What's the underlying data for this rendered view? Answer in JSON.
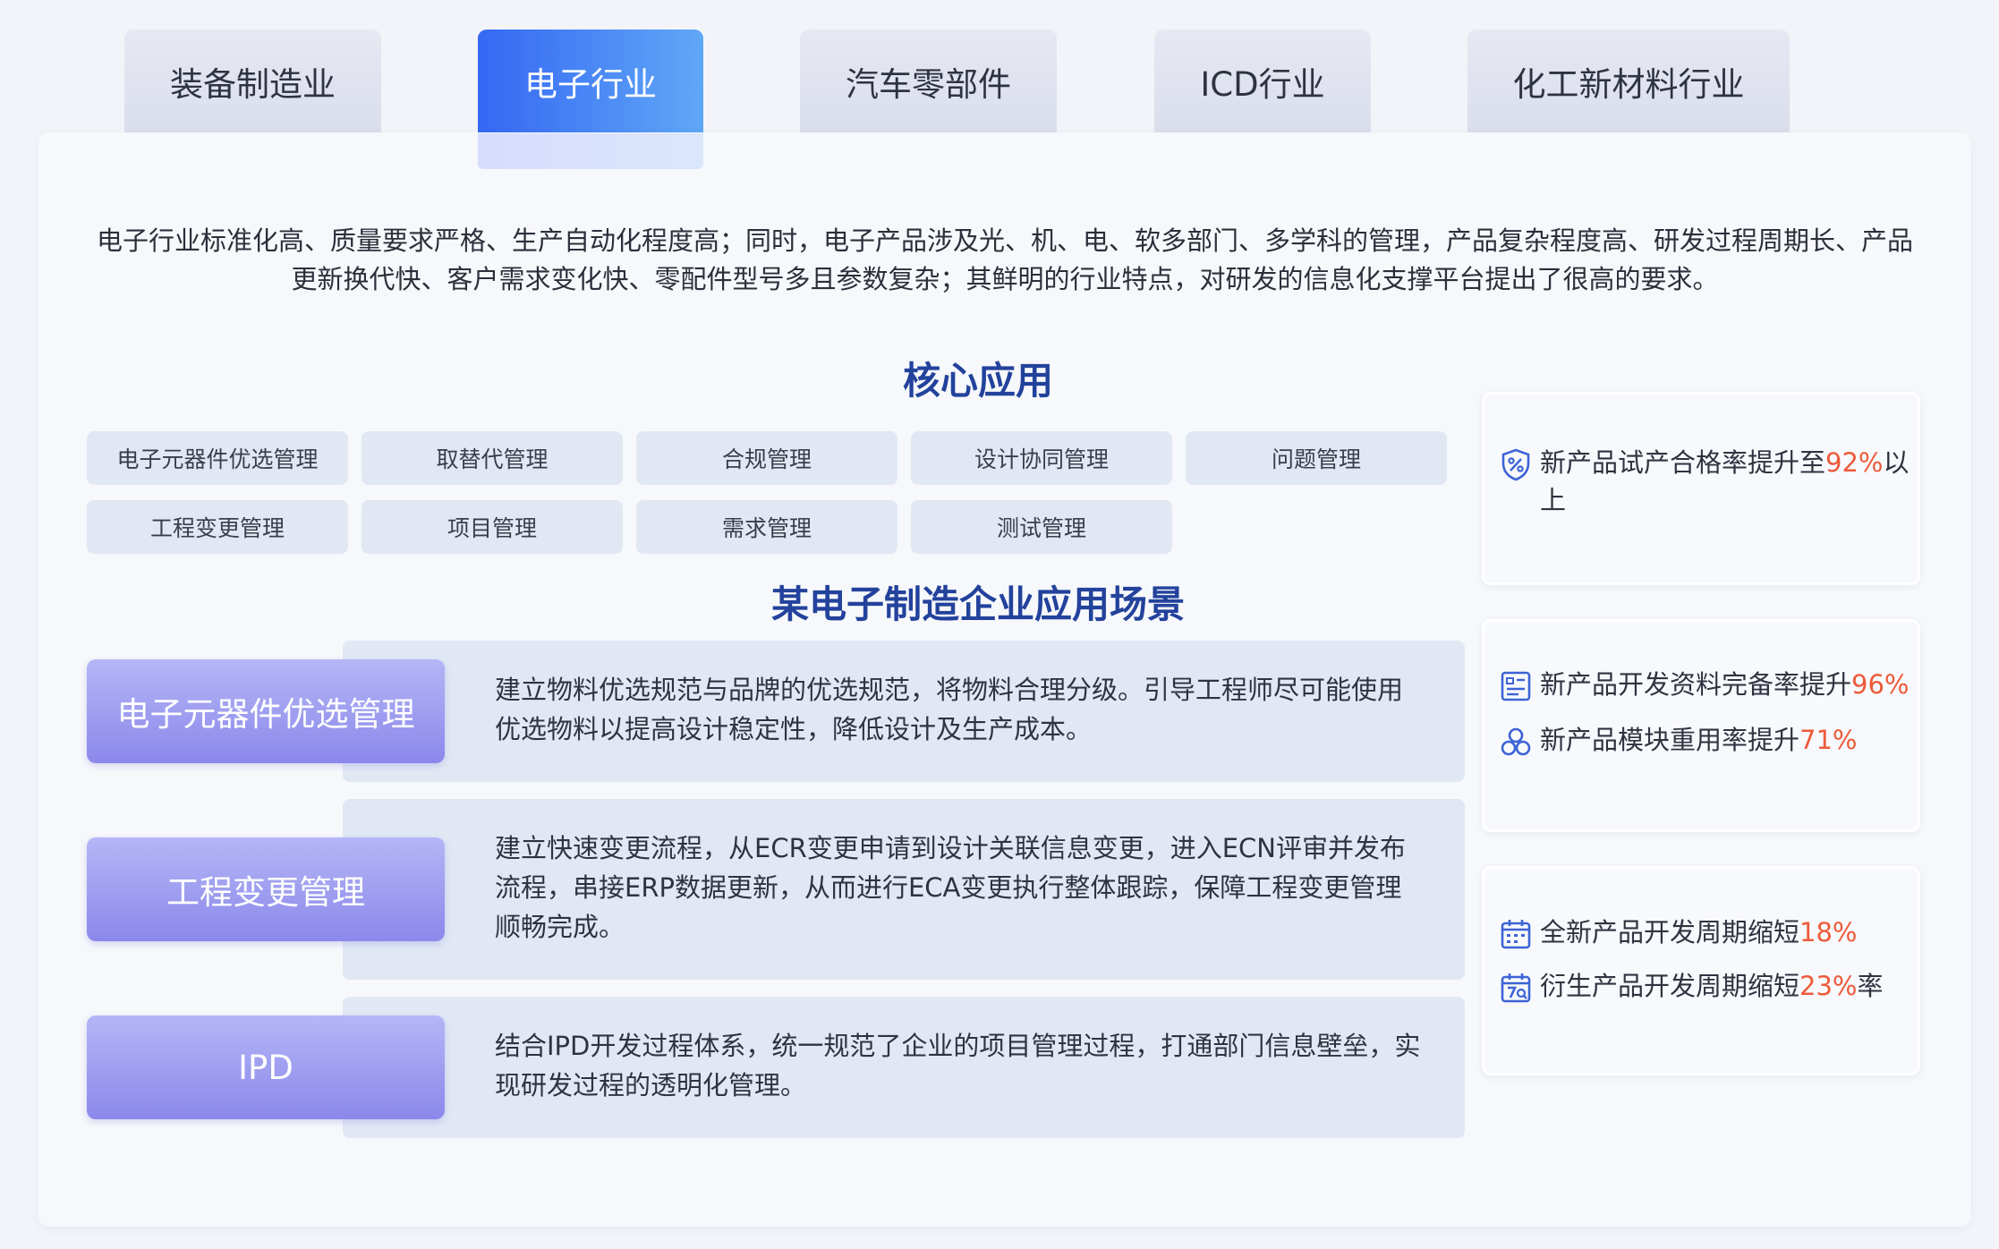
{
  "tabs": [
    {
      "label": "装备制造业",
      "active": false
    },
    {
      "label": "电子行业",
      "active": true
    },
    {
      "label": "汽车零部件",
      "active": false
    },
    {
      "label": "ICD行业",
      "active": false
    },
    {
      "label": "化工新材料行业",
      "active": false
    }
  ],
  "intro": "电子行业标准化高、质量要求严格、生产自动化程度高；同时，电子产品涉及光、机、电、软多部门、多学科的管理，产品复杂程度高、研发过程周期长、产品更新换代快、客户需求变化快、零配件型号多且参数复杂；其鲜明的行业特点，对研发的信息化支撑平台提出了很高的要求。",
  "core": {
    "title": "核心应用",
    "chips": [
      "电子元器件优选管理",
      "取替代管理",
      "合规管理",
      "设计协同管理",
      "问题管理",
      "工程变更管理",
      "项目管理",
      "需求管理",
      "测试管理"
    ]
  },
  "scene": {
    "title": "某电子制造企业应用场景",
    "rows": [
      {
        "label": "电子元器件优选管理",
        "text": "建立物料优选规范与品牌的优选规范，将物料合理分级。引导工程师尽可能使用优选物料以提高设计稳定性，降低设计及生产成本。"
      },
      {
        "label": "工程变更管理",
        "text": "建立快速变更流程，从ECR变更申请到设计关联信息变更，进入ECN评审并发布流程，串接ERP数据更新，从而进行ECA变更执行整体跟踪，保障工程变更管理顺畅完成。"
      },
      {
        "label": "IPD",
        "text": "结合IPD开发过程体系，统一规范了企业的项目管理过程，打通部门信息壁垒，实现研发过程的透明化管理。"
      }
    ]
  },
  "metrics": {
    "card1": [
      {
        "icon": "shield-percent-icon",
        "pre": "新产品试产合格率提升至",
        "value": "92%",
        "post": "以上"
      }
    ],
    "card2": [
      {
        "icon": "document-list-icon",
        "pre": "新产品开发资料完备率提升",
        "value": "96%",
        "post": ""
      },
      {
        "icon": "modules-icon",
        "pre": "新产品模块重用率提升",
        "value": "71%",
        "post": ""
      }
    ],
    "card3": [
      {
        "icon": "calendar-icon",
        "pre": "全新产品开发周期缩短",
        "value": "18%",
        "post": ""
      },
      {
        "icon": "calendar-seven-icon",
        "pre": "衍生产品开发周期缩短",
        "value": "23%",
        "post": "率"
      }
    ]
  },
  "colors": {
    "tab_active_from": "#3568f4",
    "tab_active_to": "#5fa7f6",
    "title_blue": "#23429c",
    "highlight": "#ee5a3a",
    "scene_label_from": "#b4b6f6",
    "scene_label_to": "#8b88eb",
    "icon_blue": "#3d63d6"
  }
}
